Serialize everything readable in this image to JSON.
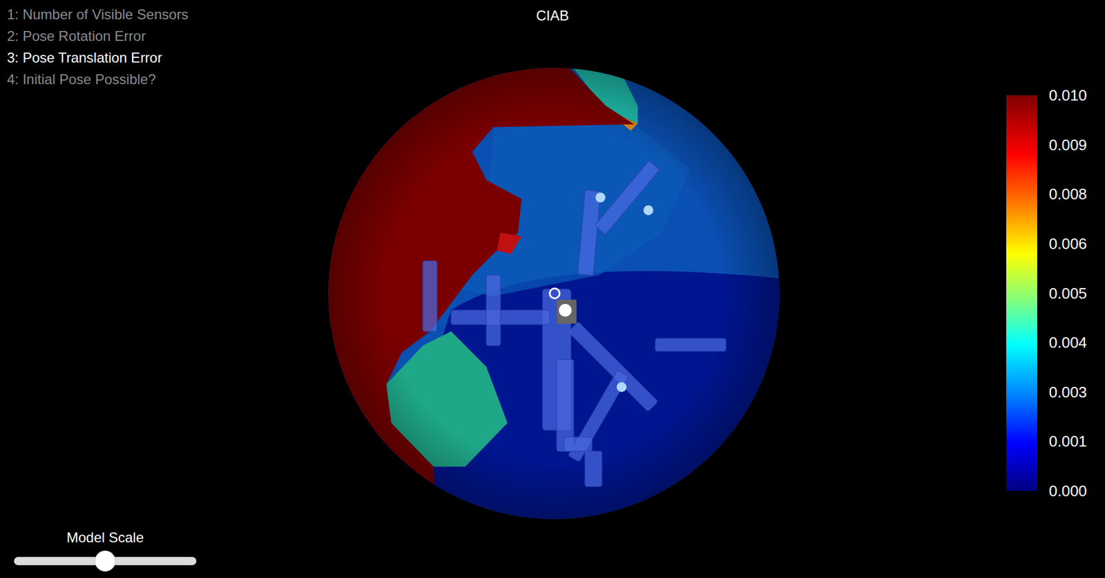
{
  "window": {
    "title": "CIAB"
  },
  "menu": [
    {
      "label": "1: Number of Visible Sensors",
      "selected": false
    },
    {
      "label": "2: Pose Rotation Error",
      "selected": false
    },
    {
      "label": "3: Pose Translation Error",
      "selected": true
    },
    {
      "label": "4: Initial Pose Possible?",
      "selected": false
    }
  ],
  "colorbar": {
    "ticks": [
      "0.010",
      "0.009",
      "0.008",
      "0.006",
      "0.005",
      "0.004",
      "0.003",
      "0.001",
      "0.000"
    ]
  },
  "slider": {
    "label": "Model Scale",
    "level": 0.5
  }
}
